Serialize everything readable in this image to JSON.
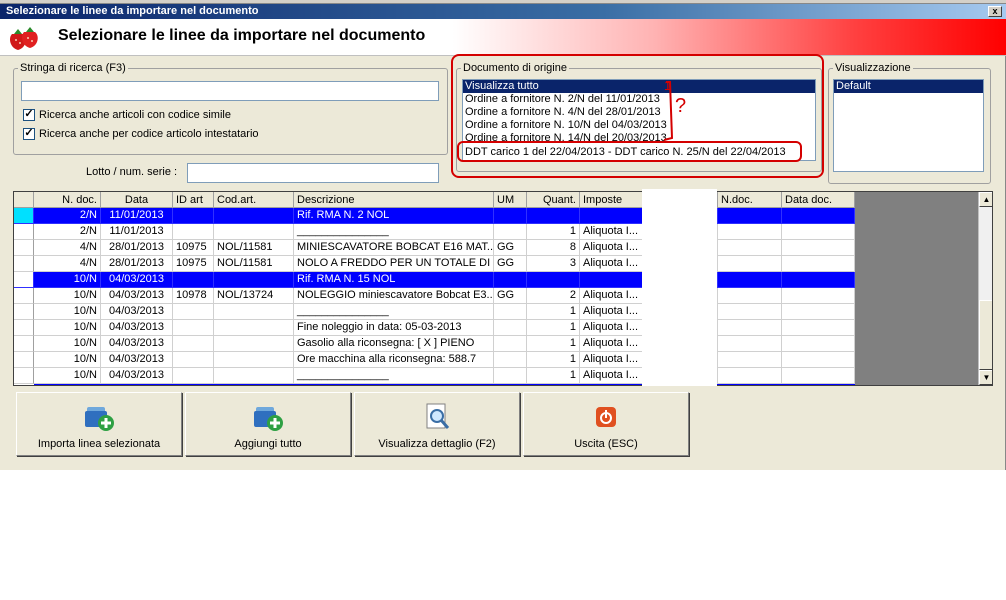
{
  "window": {
    "title": "Selezionare le linee da importare nel documento"
  },
  "banner": {
    "title": "Selezionare le linee da importare nel documento"
  },
  "search": {
    "legend": "Stringa di ricerca (F3)",
    "value": "",
    "chk_similar": "Ricerca anche articoli con codice simile",
    "chk_owner": "Ricerca anche per codice articolo intestatario",
    "lotto_label": "Lotto / num. serie :",
    "lotto_value": ""
  },
  "origin": {
    "legend": "Documento di origine",
    "items": [
      "Visualizza tutto",
      "Ordine a fornitore N. 2/N del 11/01/2013",
      "Ordine a fornitore N. 4/N del 28/01/2013",
      "Ordine a fornitore N. 10/N del 04/03/2013",
      "Ordine a fornitore N. 14/N del 20/03/2013",
      "DDT carico 1 del 22/04/2013 - DDT carico N. 25/N del 22/04/2013"
    ],
    "selected_index": 0,
    "annotation_number": "1",
    "annotation_question": "?",
    "annotation_color": "#d40000"
  },
  "view": {
    "legend": "Visualizzazione",
    "items": [
      "Default"
    ]
  },
  "grid": {
    "columns": [
      "N. doc.",
      "Data",
      "ID art",
      "Cod.art.",
      "Descrizione",
      "UM",
      "Quant.",
      "Imposte",
      "N.doc.",
      "Data doc."
    ],
    "rows": [
      {
        "ndoc": "2/N",
        "data": "11/01/2013",
        "idart": "",
        "codart": "",
        "descr": "Rif. RMA N. 2 NOL",
        "um": "",
        "qty": "",
        "imp": "",
        "hl": true
      },
      {
        "ndoc": "2/N",
        "data": "11/01/2013",
        "idart": "",
        "codart": "",
        "descr": "_______________",
        "um": "",
        "qty": "1",
        "imp": "Aliquota I...",
        "hl": false
      },
      {
        "ndoc": "4/N",
        "data": "28/01/2013",
        "idart": "10975",
        "codart": "NOL/11581",
        "descr": "MINIESCAVATORE BOBCAT E16 MAT...",
        "um": "GG",
        "qty": "8",
        "imp": "Aliquota I...",
        "hl": false
      },
      {
        "ndoc": "4/N",
        "data": "28/01/2013",
        "idart": "10975",
        "codart": "NOL/11581",
        "descr": "NOLO A FREDDO  PER UN TOTALE DI ...",
        "um": "GG",
        "qty": "3",
        "imp": "Aliquota I...",
        "hl": false
      },
      {
        "ndoc": "10/N",
        "data": "04/03/2013",
        "idart": "",
        "codart": "",
        "descr": "Rif. RMA N. 15 NOL",
        "um": "",
        "qty": "",
        "imp": "",
        "hl": true
      },
      {
        "ndoc": "10/N",
        "data": "04/03/2013",
        "idart": "10978",
        "codart": "NOL/13724",
        "descr": "NOLEGGIO miniescavatore Bobcat E3...",
        "um": "GG",
        "qty": "2",
        "imp": "Aliquota I...",
        "hl": false
      },
      {
        "ndoc": "10/N",
        "data": "04/03/2013",
        "idart": "",
        "codart": "",
        "descr": "_______________",
        "um": "",
        "qty": "1",
        "imp": "Aliquota I...",
        "hl": false
      },
      {
        "ndoc": "10/N",
        "data": "04/03/2013",
        "idart": "",
        "codart": "",
        "descr": "Fine noleggio in data: 05-03-2013",
        "um": "",
        "qty": "1",
        "imp": "Aliquota I...",
        "hl": false
      },
      {
        "ndoc": "10/N",
        "data": "04/03/2013",
        "idart": "",
        "codart": "",
        "descr": "Gasolio alla riconsegna: [ X ] PIENO",
        "um": "",
        "qty": "1",
        "imp": "Aliquota I...",
        "hl": false
      },
      {
        "ndoc": "10/N",
        "data": "04/03/2013",
        "idart": "",
        "codart": "",
        "descr": "Ore macchina alla riconsegna: 588.7",
        "um": "",
        "qty": "1",
        "imp": "Aliquota I...",
        "hl": false
      },
      {
        "ndoc": "10/N",
        "data": "04/03/2013",
        "idart": "",
        "codart": "",
        "descr": "_______________",
        "um": "",
        "qty": "1",
        "imp": "Aliquota I...",
        "hl": false
      }
    ],
    "highlight_color": "#0000ff"
  },
  "buttons": {
    "import": "Importa linea selezionata",
    "add_all": "Aggiungi tutto",
    "detail": "Visualizza dettaglio (F2)",
    "exit": "Uscita (ESC)"
  }
}
